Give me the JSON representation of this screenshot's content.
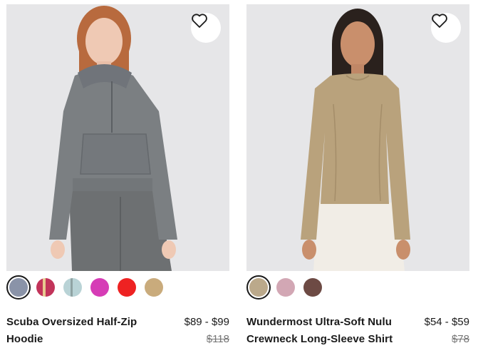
{
  "products": [
    {
      "name": "Scuba Oversized Half-Zip Hoodie",
      "price": "$89 - $99",
      "original_price": "$118",
      "image": "model-in-grey-half-zip-hoodie-and-grey-cargo-pants",
      "favorite_icon": "heart-outline-icon",
      "swatches": [
        {
          "color": "#8a93a8",
          "selected": true
        },
        {
          "color": "#c2345a",
          "selected": false,
          "pattern": "stripe"
        },
        {
          "color": "#b9d3d6",
          "selected": false,
          "pattern": "stripe"
        },
        {
          "color": "#d63cb6",
          "selected": false
        },
        {
          "color": "#ee2222",
          "selected": false
        },
        {
          "color": "#c9ab7c",
          "selected": false
        }
      ]
    },
    {
      "name": "Wundermost Ultra-Soft Nulu Crewneck Long-Sleeve Shirt",
      "price": "$54 - $59",
      "original_price": "$78",
      "image": "model-in-tan-long-sleeve-shirt-and-cream-pants",
      "favorite_icon": "heart-outline-icon",
      "swatches": [
        {
          "color": "#bba98b",
          "selected": true
        },
        {
          "color": "#d2a7b4",
          "selected": false
        },
        {
          "color": "#6d4a44",
          "selected": false
        }
      ]
    }
  ]
}
